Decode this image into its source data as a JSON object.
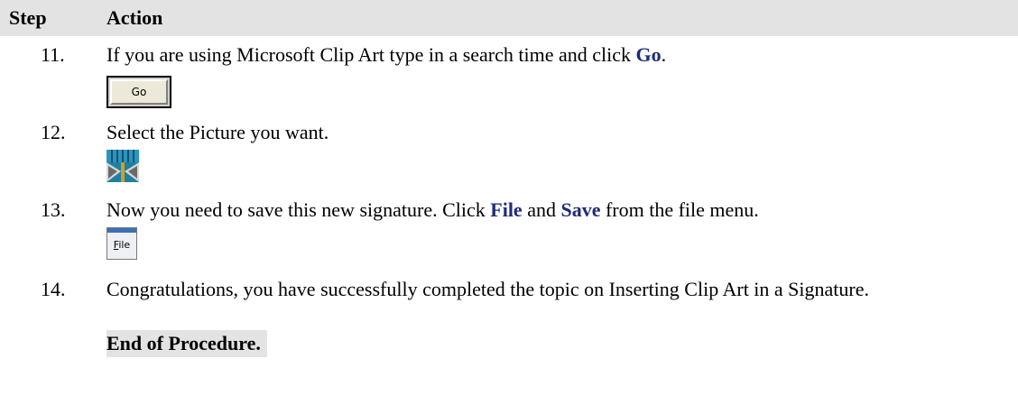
{
  "header": {
    "step": "Step",
    "action": "Action"
  },
  "steps": [
    {
      "number": "11.",
      "text_before": "If you are using Microsoft Clip Art type in a search time and click ",
      "keyword1": "Go",
      "text_after": ".",
      "button_label": "Go"
    },
    {
      "number": "12.",
      "text": "Select the Picture you want."
    },
    {
      "number": "13.",
      "text_before": "Now you need to save this new signature. Click ",
      "keyword1": "File",
      "text_mid": " and ",
      "keyword2": "Save",
      "text_after": " from the file menu.",
      "button_label_first": "F",
      "button_label_rest": "ile"
    },
    {
      "number": "14.",
      "text": "Congratulations, you have successfully completed the topic on Inserting Clip Art in a Signature."
    }
  ],
  "end_label": "End of Procedure.",
  "colors": {
    "keyword": "#1f2a7a",
    "header_bg": "#e3e3e3"
  }
}
